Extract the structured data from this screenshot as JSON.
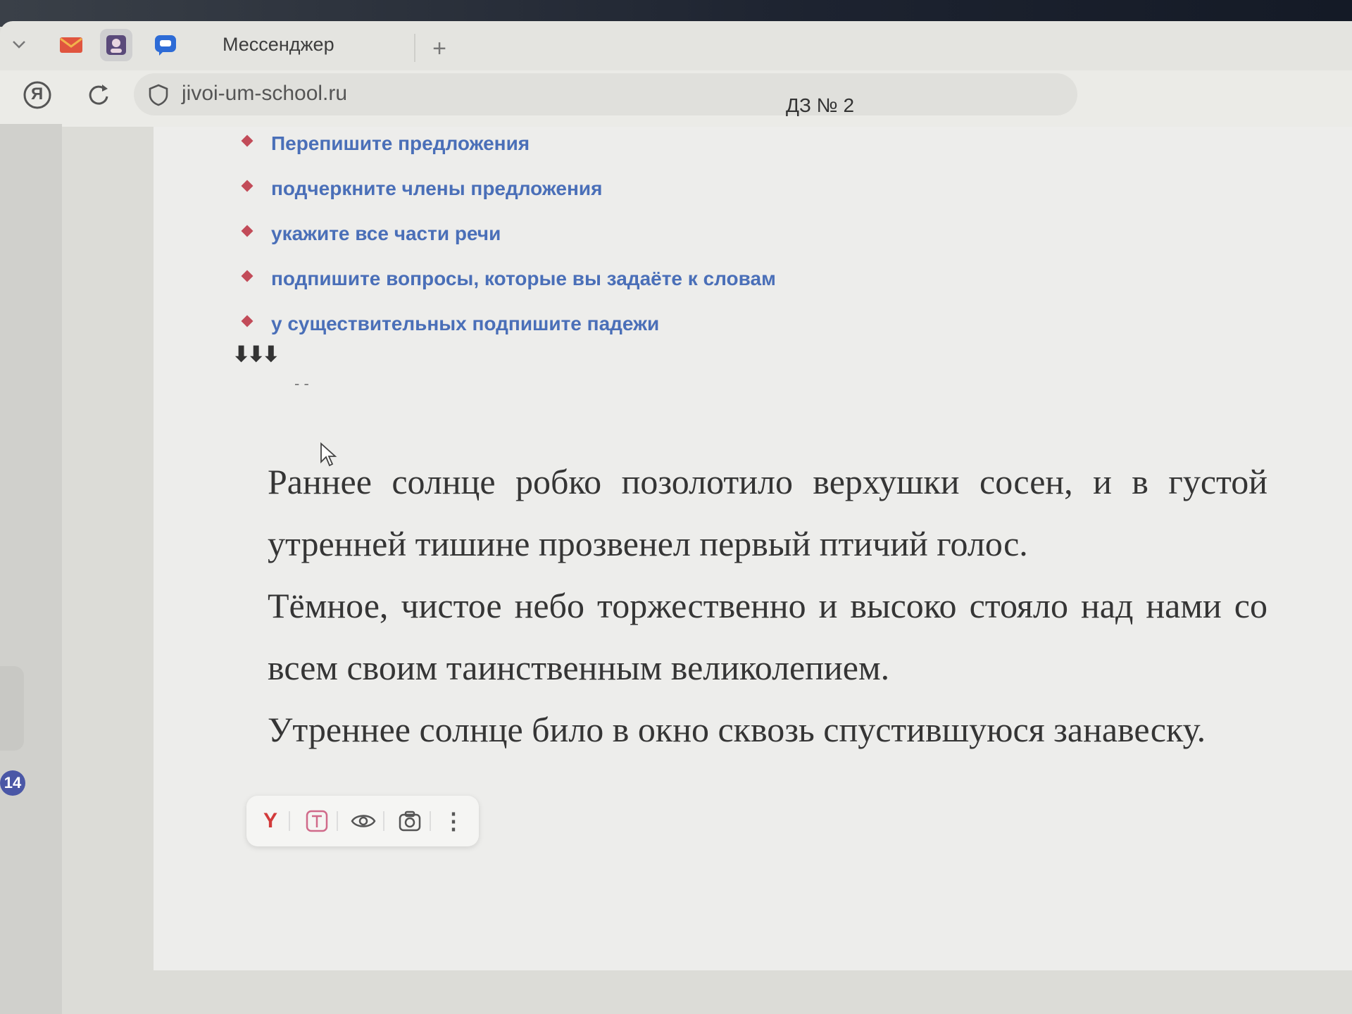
{
  "browser": {
    "active_tab_title": "Мессенджер",
    "new_tab_symbol": "+",
    "address_url": "jivoi-um-school.ru",
    "yandex_button_symbol": "Я",
    "icons": [
      "chevron-down-icon",
      "mail-icon",
      "profile-icon",
      "messenger-icon",
      "yandex-icon",
      "reload-icon",
      "shield-icon"
    ]
  },
  "document": {
    "title": "ДЗ № 2",
    "instructions": [
      "Перепишите предложения",
      "подчеркните члены предложения",
      "укажите все части речи",
      "подпишите вопросы, которые вы задаёте к словам",
      "у существительных подпишите падежи"
    ],
    "arrows": "⬇⬇⬇",
    "dashes": "- -",
    "paragraphs": [
      "Раннее солнце робко позолотило верхушки сосен, и в густой утренней тишине прозвенел первый птичий голос.",
      "Тёмное, чистое небо торжественно и высоко стояло над нами со всем своим таинственным великолепием.",
      "Утреннее солнце било в окно сквозь спустившуюся занавеску."
    ]
  },
  "sidebar": {
    "badge_count": "14"
  },
  "selection_toolbar": {
    "yandex_label": "Y",
    "more_symbol": "⋮",
    "icons": [
      "yandex-icon",
      "translate-icon",
      "eye-icon",
      "screenshot-icon",
      "more-icon"
    ]
  },
  "colors": {
    "instruction_text": "#4a6fb8",
    "bullet": "#c24b58",
    "badge": "#4a57a6",
    "body_text": "#353535"
  }
}
